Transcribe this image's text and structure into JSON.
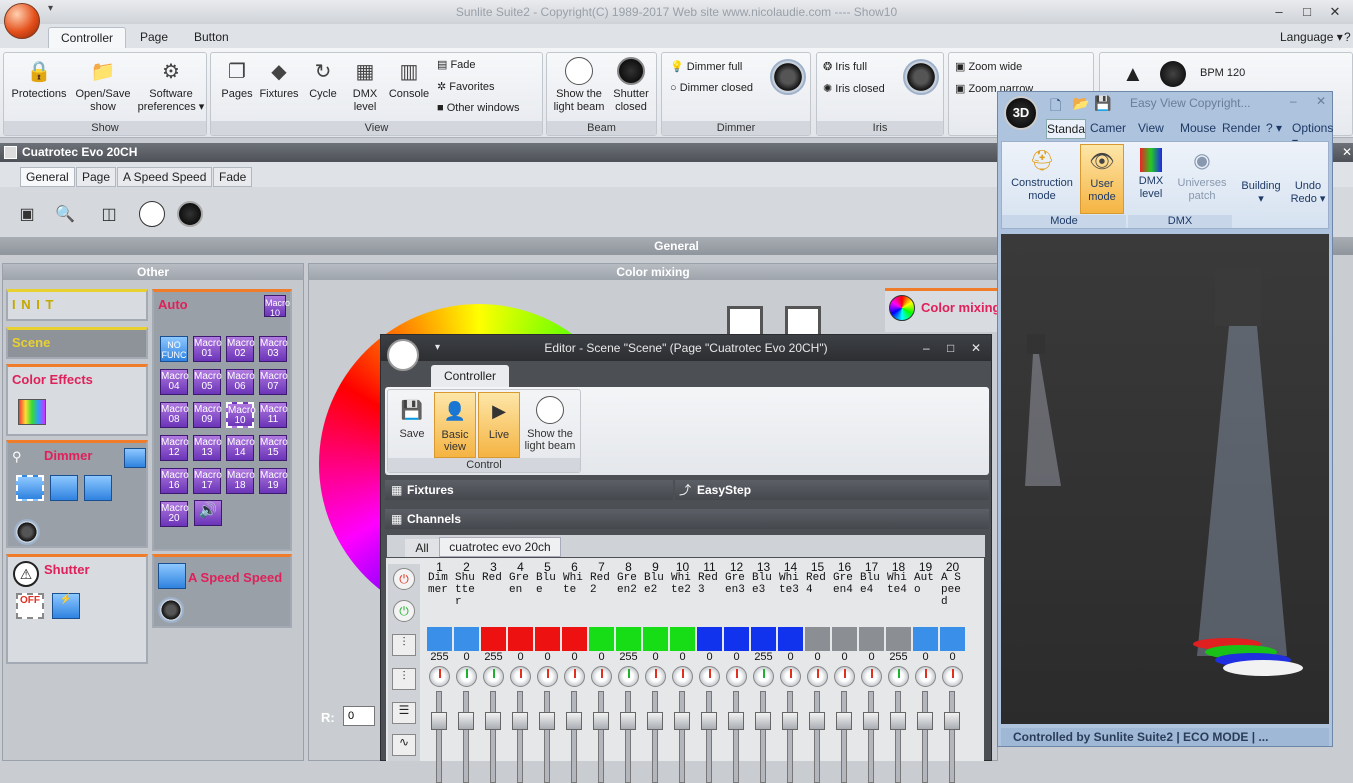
{
  "window": {
    "title": "Sunlite Suite2 - Copyright(C) 1989-2017    Web site www.nicolaudie.com ---- Show10",
    "minimize": "–",
    "maximize": "□",
    "close": "✕"
  },
  "menu": {
    "tabs": [
      "Controller",
      "Page",
      "Button"
    ],
    "language": "Language ▾",
    "help": "?"
  },
  "ribbon": {
    "show": {
      "label": "Show",
      "protections": "Protections",
      "open_save_l1": "Open/Save",
      "open_save_l2": "show",
      "software_l1": "Software",
      "software_l2": "preferences ▾"
    },
    "view": {
      "label": "View",
      "pages": "Pages",
      "fixtures": "Fixtures",
      "cycle": "Cycle",
      "dmx_l1": "DMX",
      "dmx_l2": "level",
      "console": "Console",
      "fade": "Fade",
      "favorites": "Favorites",
      "other_windows": "Other windows"
    },
    "beam": {
      "label": "Beam",
      "show_l1": "Show the",
      "show_l2": "light beam",
      "shutter_l1": "Shutter",
      "shutter_l2": "closed"
    },
    "dimmer": {
      "label": "Dimmer",
      "full": "Dimmer full",
      "closed": "Dimmer closed"
    },
    "iris": {
      "label": "Iris",
      "full": "Iris full",
      "closed": "Iris closed"
    },
    "zoom": {
      "wide": "Zoom wide",
      "narrow": "Zoom narrow"
    },
    "bpm": "BPM 120"
  },
  "page": {
    "title": "Cuatrotec Evo 20CH",
    "tabs": [
      "General",
      "Page",
      "A Speed Speed",
      "Fade"
    ],
    "general_bar": "General",
    "other_header": "Other",
    "color_mixing_header": "Color mixing",
    "cards": {
      "init": "I N I T",
      "scene": "Scene",
      "color_effects": "Color Effects",
      "dimmer": "Dimmer",
      "shutter": "Shutter",
      "auto": "Auto",
      "speed": "A Speed Speed",
      "color_mixing": "Color mixing"
    },
    "macros": [
      "Macro 01",
      "Macro 02",
      "Macro 03",
      "Macro 04",
      "Macro 05",
      "Macro 06",
      "Macro 07",
      "Macro 08",
      "Macro 09",
      "Macro 10",
      "Macro 11",
      "Macro 12",
      "Macro 13",
      "Macro 14",
      "Macro 15",
      "Macro 16",
      "Macro 17",
      "Macro 18",
      "Macro 19",
      "Macro 20"
    ],
    "macro_top": "Macro 10",
    "nofunc": "NO FUNC",
    "off": "OFF",
    "r_label": "R:",
    "r_value": "0"
  },
  "editor": {
    "title": "Editor - Scene \"Scene\" (Page \"Cuatrotec Evo 20CH\")",
    "tab": "Controller",
    "save": "Save",
    "basic_l1": "Basic",
    "basic_l2": "view",
    "live": "Live",
    "show_l1": "Show the",
    "show_l2": "light beam",
    "group": "Control",
    "fixtures": "Fixtures",
    "easystep": "EasyStep",
    "channels": "Channels",
    "tab_all": "All",
    "tab_fixture": "cuatrotec evo 20ch"
  },
  "channels": [
    {
      "n": "1",
      "name": "Dimmer",
      "val": "255",
      "color": "#3a8fe8",
      "on": false
    },
    {
      "n": "2",
      "name": "Shutter",
      "val": "0",
      "color": "#3a8fe8",
      "on": true
    },
    {
      "n": "3",
      "name": "Red",
      "val": "255",
      "color": "#ee1111",
      "on": true
    },
    {
      "n": "4",
      "name": "Green",
      "val": "0",
      "color": "#ee1111",
      "on": false
    },
    {
      "n": "5",
      "name": "Blue",
      "val": "0",
      "color": "#ee1111",
      "on": false
    },
    {
      "n": "6",
      "name": "White",
      "val": "0",
      "color": "#ee1111",
      "on": false
    },
    {
      "n": "7",
      "name": "Red2",
      "val": "0",
      "color": "#16dd16",
      "on": false
    },
    {
      "n": "8",
      "name": "Green2",
      "val": "255",
      "color": "#16dd16",
      "on": true
    },
    {
      "n": "9",
      "name": "Blue2",
      "val": "0",
      "color": "#16dd16",
      "on": false
    },
    {
      "n": "10",
      "name": "White2",
      "val": "0",
      "color": "#16dd16",
      "on": false
    },
    {
      "n": "11",
      "name": "Red3",
      "val": "0",
      "color": "#1133ee",
      "on": false
    },
    {
      "n": "12",
      "name": "Green3",
      "val": "0",
      "color": "#1133ee",
      "on": false
    },
    {
      "n": "13",
      "name": "Blue3",
      "val": "255",
      "color": "#1133ee",
      "on": true
    },
    {
      "n": "14",
      "name": "White3",
      "val": "0",
      "color": "#1133ee",
      "on": false
    },
    {
      "n": "15",
      "name": "Red4",
      "val": "0",
      "color": "#8b8e93",
      "on": false
    },
    {
      "n": "16",
      "name": "Green4",
      "val": "0",
      "color": "#8b8e93",
      "on": false
    },
    {
      "n": "17",
      "name": "Blue4",
      "val": "0",
      "color": "#8b8e93",
      "on": false
    },
    {
      "n": "18",
      "name": "White4",
      "val": "255",
      "color": "#8b8e93",
      "on": true
    },
    {
      "n": "19",
      "name": "Auto",
      "val": "0",
      "color": "#3a8fe8",
      "on": false
    },
    {
      "n": "20",
      "name": "A Speed",
      "val": "0",
      "color": "#3a8fe8",
      "on": false
    }
  ],
  "win3d": {
    "title": "Easy View    Copyright...",
    "tabs": [
      "Standa",
      "Camera",
      "View",
      "Mouse",
      "Render",
      "? ▾",
      "Options ▾"
    ],
    "construction_l1": "Construction",
    "construction_l2": "mode",
    "user_l1": "User",
    "user_l2": "mode",
    "dmx_l1": "DMX",
    "dmx_l2": "level",
    "universes_l1": "Universes",
    "universes_l2": "patch",
    "building": "Building",
    "undo": "Undo",
    "redo": "Redo ▾",
    "grp_mode": "Mode",
    "grp_dmx": "DMX",
    "status": "Controlled by Sunlite Suite2  |  ECO MODE  |  ..."
  }
}
